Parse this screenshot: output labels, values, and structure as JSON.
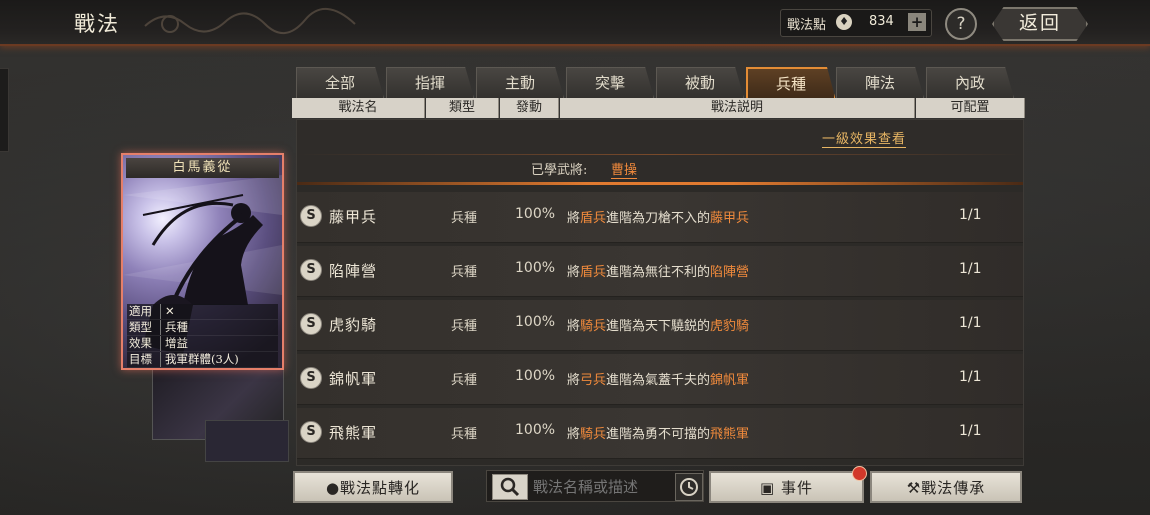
{
  "header": {
    "title": "戰法",
    "points_label": "戰法點",
    "points_value": "834",
    "plus": "+",
    "help": "?",
    "back_label": "返回"
  },
  "tabs": [
    "全部",
    "指揮",
    "主動",
    "突擊",
    "被動",
    "兵種",
    "陣法",
    "內政"
  ],
  "active_tab": "兵種",
  "columns": [
    "戰法名",
    "類型",
    "發動",
    "戰法説明",
    "可配置"
  ],
  "detail": {
    "effect_link": "一級效果查看",
    "learned_label": "已學武將:",
    "learned_name": "曹操"
  },
  "card": {
    "title": "白馬義從",
    "rows": [
      {
        "key": "適用",
        "val": ""
      },
      {
        "key": "類型",
        "val": "兵種"
      },
      {
        "key": "效果",
        "val": "增益"
      },
      {
        "key": "目標",
        "val": "我軍群體(3人)"
      }
    ]
  },
  "tactics": [
    {
      "grade": "S",
      "name": "藤甲兵",
      "type": "兵種",
      "rate": "100%",
      "desc_pre": "將",
      "desc_from": "盾兵",
      "desc_mid": "進階為刀槍不入的",
      "desc_to": "藤甲兵",
      "count": "1/1"
    },
    {
      "grade": "S",
      "name": "陷陣營",
      "type": "兵種",
      "rate": "100%",
      "desc_pre": "將",
      "desc_from": "盾兵",
      "desc_mid": "進階為無往不利的",
      "desc_to": "陷陣營",
      "count": "1/1"
    },
    {
      "grade": "S",
      "name": "虎豹騎",
      "type": "兵種",
      "rate": "100%",
      "desc_pre": "將",
      "desc_from": "騎兵",
      "desc_mid": "進階為天下驍鋭的",
      "desc_to": "虎豹騎",
      "count": "1/1"
    },
    {
      "grade": "S",
      "name": "錦帆軍",
      "type": "兵種",
      "rate": "100%",
      "desc_pre": "將",
      "desc_from": "弓兵",
      "desc_mid": "進階為氣蓋千夫的",
      "desc_to": "錦帆軍",
      "count": "1/1"
    },
    {
      "grade": "S",
      "name": "飛熊軍",
      "type": "兵種",
      "rate": "100%",
      "desc_pre": "將",
      "desc_from": "騎兵",
      "desc_mid": "進階為勇不可擋的",
      "desc_to": "飛熊軍",
      "count": "1/1"
    }
  ],
  "bottom": {
    "convert_label": "戰法點轉化",
    "search_placeholder": "戰法名稱或描述",
    "event_label": "事件",
    "inherit_label": "戰法傳承"
  },
  "colors": {
    "accent": "#e38c35",
    "highlight": "#f08a3c",
    "card_border": "#e57f6a"
  }
}
